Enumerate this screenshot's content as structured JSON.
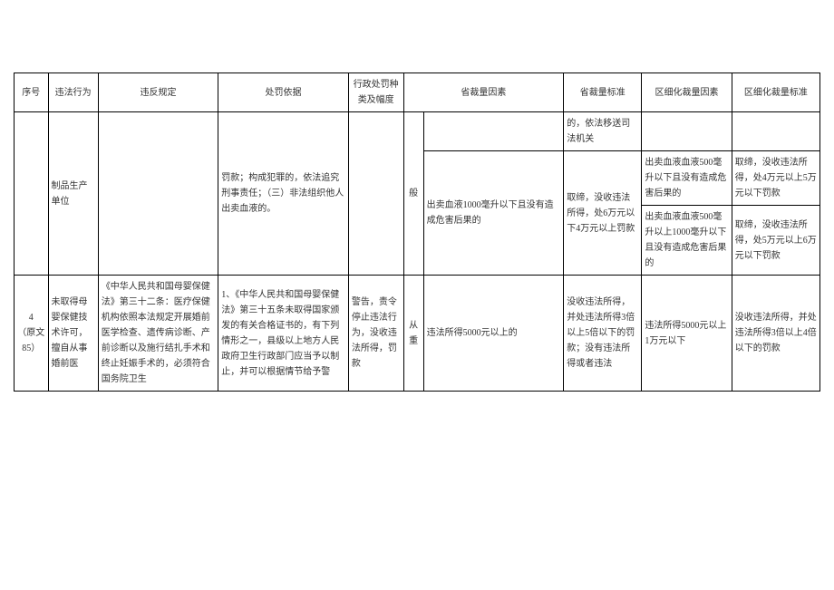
{
  "headers": {
    "seq": "序号",
    "action": "违法行为",
    "violation": "违反规定",
    "basis": "处罚依据",
    "type": "行政处罚种类及幅度",
    "pfactor": "省裁量因素",
    "pstandard": "省裁量标准",
    "dfactor": "区细化裁量因素",
    "dstandard": "区细化裁量标准"
  },
  "row1": {
    "action_extra": "制品生产单位",
    "basis_extra": "罚款；构成犯罪的，依法追究刑事责任；（三）非法组织他人出卖血液的。",
    "pstandard_cell1": "的，依法移送司法机关",
    "level": "般",
    "pfactor": "出卖血液1000毫升以下且没有造成危害后果的",
    "pstandard_cell2": "取缔，没收违法所得，处6万元以下4万元以上罚款",
    "dfactor_a": "出卖血液血液500毫升以下且没有造成危害后果的",
    "dstandard_a": "取缔，没收违法所得，处4万元以上5万元以下罚款",
    "dfactor_b": "出卖血液血液500毫升以上1000毫升以下且没有造成危害后果的",
    "dstandard_b": "取缔，没收违法所得，处5万元以上6万元以下罚款"
  },
  "row2": {
    "seq": "4\n（原文85）",
    "action": "未取得母婴保健技术许可，擅自从事婚前医",
    "violation": "《中华人民共和国母婴保健法》第三十二条：医疗保健机构依照本法规定开展婚前医学检查、遗传病诊断、产前诊断以及施行结扎手术和终止妊娠手术的，必须符合国务院卫生",
    "basis": "1、《中华人民共和国母婴保健法》第三十五条未取得国家颁发的有关合格证书的，有下列情形之一，县级以上地方人民政府卫生行政部门应当予以制止，并可以根据情节给予警",
    "type": "警告，责令停止违法行为，没收违法所得，罚款",
    "level": "从重",
    "pfactor": "违法所得5000元以上的",
    "pstandard": "没收违法所得，并处违法所得3倍以上5倍以下的罚款；没有违法所得或者违法",
    "dfactor": "违法所得5000元以上1万元以下",
    "dstandard": "没收违法所得，并处违法所得3倍以上4倍以下的罚款"
  }
}
